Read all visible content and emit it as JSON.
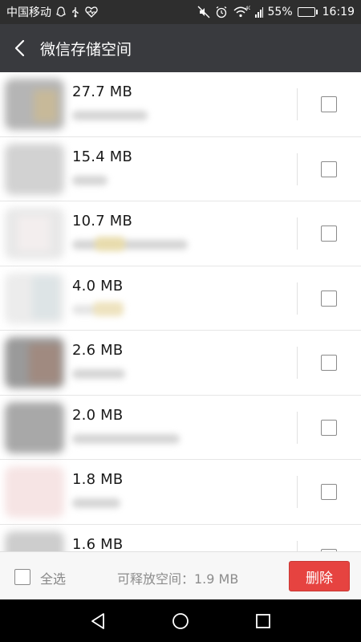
{
  "status_bar": {
    "carrier": "中国移动",
    "signal_label": "4G",
    "battery": "55%",
    "battery_level": 0.55,
    "time": "16:19"
  },
  "header": {
    "title": "微信存储空间"
  },
  "items": [
    {
      "size": "27.7 MB",
      "checked": false
    },
    {
      "size": "15.4 MB",
      "checked": false
    },
    {
      "size": "10.7 MB",
      "checked": false
    },
    {
      "size": "4.0 MB",
      "checked": false
    },
    {
      "size": "2.6 MB",
      "checked": false
    },
    {
      "size": "2.0 MB",
      "checked": false
    },
    {
      "size": "1.8 MB",
      "checked": false
    },
    {
      "size": "1.6 MB",
      "checked": false
    }
  ],
  "footer": {
    "select_all_label": "全选",
    "freeable_text": "可释放空间：1.9 MB",
    "delete_label": "删除"
  },
  "colors": {
    "header_bg": "#393a3e",
    "status_bg": "#2e2e2e",
    "delete_bg": "#e64340",
    "battery_green": "#2fd15a"
  }
}
